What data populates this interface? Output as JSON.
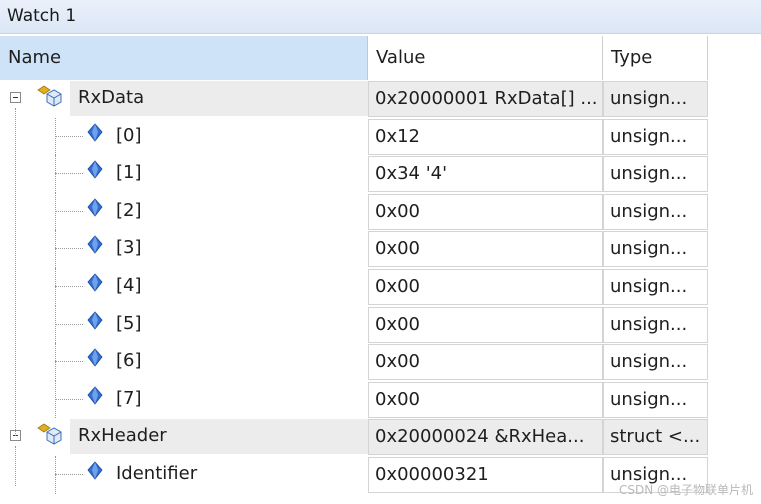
{
  "window": {
    "title": "Watch 1"
  },
  "columns": {
    "name": "Name",
    "value": "Value",
    "type": "Type"
  },
  "rows": [
    {
      "name": "RxData",
      "value": "0x20000001 RxData[] ...",
      "type": "unsign...",
      "level": 0,
      "expanded": true,
      "icon": "struct-object-icon"
    },
    {
      "name": "[0]",
      "value": "0x12",
      "type": "unsign...",
      "level": 1,
      "icon": "variable-icon"
    },
    {
      "name": "[1]",
      "value": "0x34 '4'",
      "type": "unsign...",
      "level": 1,
      "icon": "variable-icon"
    },
    {
      "name": "[2]",
      "value": "0x00",
      "type": "unsign...",
      "level": 1,
      "icon": "variable-icon"
    },
    {
      "name": "[3]",
      "value": "0x00",
      "type": "unsign...",
      "level": 1,
      "icon": "variable-icon"
    },
    {
      "name": "[4]",
      "value": "0x00",
      "type": "unsign...",
      "level": 1,
      "icon": "variable-icon"
    },
    {
      "name": "[5]",
      "value": "0x00",
      "type": "unsign...",
      "level": 1,
      "icon": "variable-icon"
    },
    {
      "name": "[6]",
      "value": "0x00",
      "type": "unsign...",
      "level": 1,
      "icon": "variable-icon"
    },
    {
      "name": "[7]",
      "value": "0x00",
      "type": "unsign...",
      "level": 1,
      "icon": "variable-icon"
    },
    {
      "name": "RxHeader",
      "value": "0x20000024 &RxHea...",
      "type": "struct <...",
      "level": 0,
      "expanded": true,
      "icon": "struct-object-icon"
    },
    {
      "name": "Identifier",
      "value": "0x00000321",
      "type": "unsign...",
      "level": 1,
      "icon": "variable-icon"
    }
  ],
  "watermark": "CSDN @电子物联单片机",
  "colors": {
    "header_name_bg": "#cfe3f8",
    "parent_row_bg": "#ececec",
    "variable_icon": "#2f6fd6",
    "struct_icon_accent": "#e0b020"
  }
}
